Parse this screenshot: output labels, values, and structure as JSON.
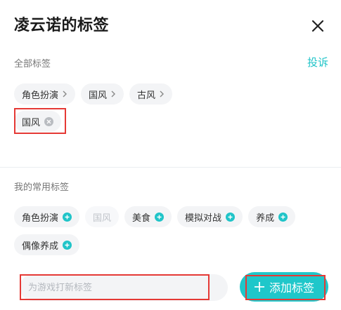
{
  "header": {
    "title": "凌云诺的标签"
  },
  "all_tags": {
    "label": "全部标签",
    "report": "投诉",
    "categories": [
      {
        "label": "角色扮演"
      },
      {
        "label": "国风"
      },
      {
        "label": "古风"
      }
    ],
    "selected": [
      {
        "label": "国风"
      }
    ]
  },
  "common_tags": {
    "label": "我的常用标签",
    "row1": [
      {
        "label": "角色扮演",
        "state": "addable"
      },
      {
        "label": "国风",
        "state": "disabled"
      },
      {
        "label": "美食",
        "state": "addable"
      },
      {
        "label": "模拟对战",
        "state": "addable"
      },
      {
        "label": "养成",
        "state": "addable"
      }
    ],
    "row2": [
      {
        "label": "偶像养成",
        "state": "addable"
      }
    ]
  },
  "input": {
    "placeholder": "为游戏打新标签",
    "value": ""
  },
  "add_button": {
    "label": "添加标签"
  },
  "colors": {
    "accent": "#20c4c8",
    "highlight": "#e53935"
  }
}
